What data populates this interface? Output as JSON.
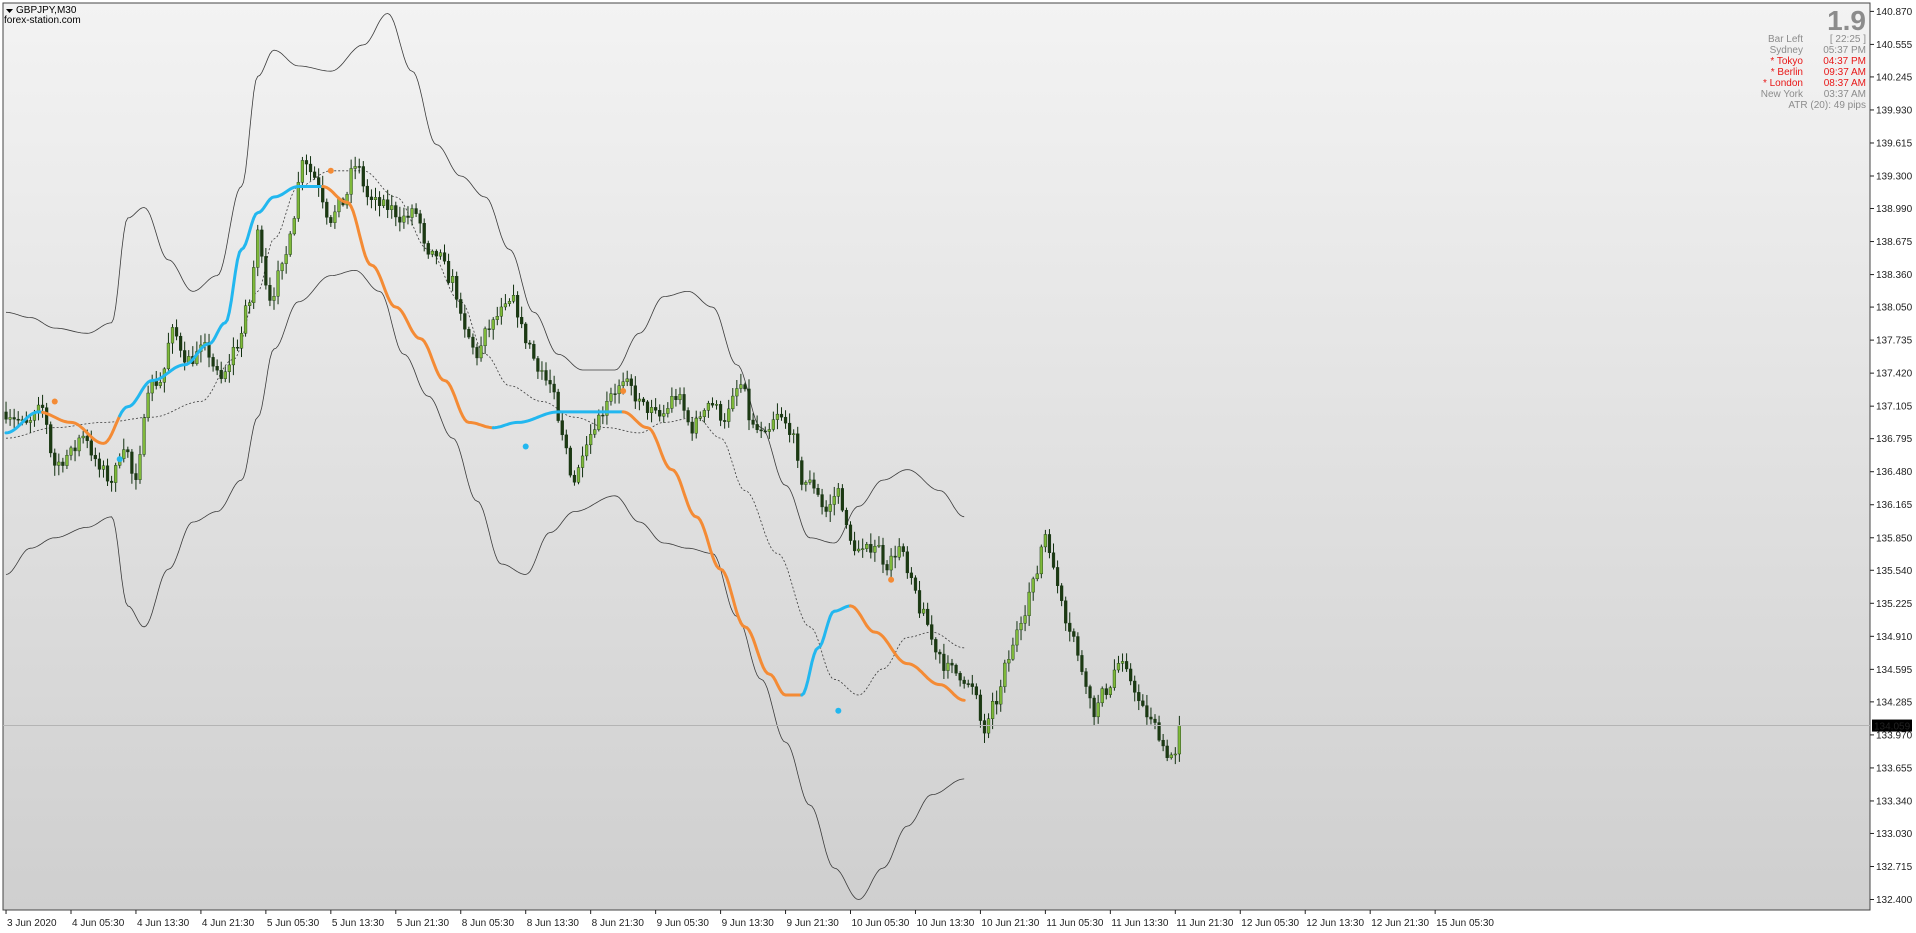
{
  "header": {
    "symbol_timeframe": "GBPJPY,M30",
    "source_watermark": "forex-station.com"
  },
  "info_panel": {
    "big_value": "1.9",
    "rows": [
      {
        "label": "Bar Left",
        "value": "[ 22:25 ]",
        "color": "#8c8c8c"
      },
      {
        "label": "Sydney",
        "value": "05:37 PM",
        "color": "#8c8c8c"
      },
      {
        "label": "* Tokyo",
        "value": "04:37 PM",
        "color": "#e81717"
      },
      {
        "label": "* Berlin",
        "value": "09:37 AM",
        "color": "#e81717"
      },
      {
        "label": "* London",
        "value": "08:37 AM",
        "color": "#e81717"
      },
      {
        "label": "New York",
        "value": "03:37 AM",
        "color": "#8c8c8c"
      }
    ],
    "atr_text": "ATR (20): 49 pips"
  },
  "colors": {
    "bull": "#7fb93a",
    "bear": "#1c3a12",
    "wick": "#123010",
    "ma_up": "#22b7ef",
    "ma_down": "#f48b35",
    "band": "#3c3c3c",
    "current_price_line": "#b4b4b4",
    "price_tag_bg": "#000000",
    "price_tag_text": "#ffffff"
  },
  "chart_data": {
    "type": "candlestick",
    "symbol": "GBPJPY",
    "timeframe": "M30",
    "ylim": [
      132.3,
      140.95
    ],
    "y_ticks": [
      140.87,
      140.555,
      140.245,
      139.93,
      139.615,
      139.3,
      138.99,
      138.675,
      138.36,
      138.05,
      137.735,
      137.42,
      137.105,
      136.795,
      136.48,
      136.165,
      135.85,
      135.54,
      135.225,
      134.91,
      134.595,
      134.285,
      133.97,
      133.655,
      133.34,
      133.03,
      132.715,
      132.4
    ],
    "x_labels": [
      "3 Jun 2020",
      "4 Jun 05:30",
      "4 Jun 13:30",
      "4 Jun 21:30",
      "5 Jun 05:30",
      "5 Jun 13:30",
      "5 Jun 21:30",
      "8 Jun 05:30",
      "8 Jun 13:30",
      "8 Jun 21:30",
      "9 Jun 05:30",
      "9 Jun 13:30",
      "9 Jun 21:30",
      "10 Jun 05:30",
      "10 Jun 13:30",
      "10 Jun 21:30",
      "11 Jun 05:30",
      "11 Jun 13:30",
      "11 Jun 21:30",
      "12 Jun 05:30",
      "12 Jun 13:30",
      "12 Jun 21:30",
      "15 Jun 05:30"
    ],
    "bars_per_label": 16,
    "current_price": 134.059,
    "price_path": [
      [
        0,
        137.05
      ],
      [
        5,
        136.92
      ],
      [
        9,
        137.08
      ],
      [
        12,
        136.55
      ],
      [
        16,
        136.65
      ],
      [
        19,
        136.85
      ],
      [
        23,
        136.5
      ],
      [
        26,
        136.4
      ],
      [
        29,
        136.75
      ],
      [
        32,
        136.35
      ],
      [
        35,
        137.3
      ],
      [
        38,
        137.35
      ],
      [
        41,
        137.8
      ],
      [
        45,
        137.55
      ],
      [
        49,
        137.65
      ],
      [
        53,
        137.35
      ],
      [
        57,
        137.7
      ],
      [
        60,
        138.1
      ],
      [
        62,
        138.75
      ],
      [
        65,
        138.15
      ],
      [
        68,
        138.4
      ],
      [
        71,
        138.95
      ],
      [
        73,
        139.5
      ],
      [
        76,
        139.3
      ],
      [
        80,
        138.9
      ],
      [
        83,
        139.05
      ],
      [
        86,
        139.4
      ],
      [
        90,
        139.05
      ],
      [
        94,
        139.0
      ],
      [
        98,
        138.9
      ],
      [
        101,
        138.95
      ],
      [
        104,
        138.5
      ],
      [
        106,
        138.55
      ],
      [
        110,
        138.3
      ],
      [
        113,
        137.8
      ],
      [
        116,
        137.6
      ],
      [
        119,
        137.85
      ],
      [
        122,
        138.0
      ],
      [
        125,
        138.1
      ],
      [
        128,
        137.75
      ],
      [
        131,
        137.5
      ],
      [
        134,
        137.3
      ],
      [
        137,
        136.8
      ],
      [
        140,
        136.4
      ],
      [
        143,
        136.8
      ],
      [
        146,
        137.0
      ],
      [
        149,
        137.25
      ],
      [
        153,
        137.3
      ],
      [
        157,
        137.1
      ],
      [
        161,
        137.0
      ],
      [
        165,
        137.2
      ],
      [
        169,
        136.9
      ],
      [
        173,
        137.15
      ],
      [
        177,
        137.0
      ],
      [
        181,
        137.3
      ],
      [
        184,
        136.9
      ],
      [
        187,
        136.8
      ],
      [
        190,
        137.0
      ],
      [
        193,
        136.9
      ],
      [
        196,
        136.4
      ],
      [
        199,
        136.35
      ],
      [
        202,
        136.1
      ],
      [
        205,
        136.3
      ],
      [
        208,
        135.8
      ],
      [
        211,
        135.7
      ],
      [
        214,
        135.8
      ],
      [
        217,
        135.6
      ],
      [
        220,
        135.75
      ],
      [
        223,
        135.4
      ],
      [
        226,
        135.1
      ],
      [
        229,
        134.8
      ],
      [
        232,
        134.6
      ],
      [
        235,
        134.55
      ],
      [
        238,
        134.4
      ],
      [
        241,
        134.0
      ],
      [
        244,
        134.3
      ],
      [
        247,
        134.7
      ],
      [
        250,
        135.1
      ],
      [
        253,
        135.4
      ],
      [
        256,
        135.9
      ],
      [
        259,
        135.4
      ],
      [
        262,
        135.0
      ],
      [
        265,
        134.6
      ],
      [
        268,
        134.2
      ],
      [
        271,
        134.4
      ],
      [
        274,
        134.65
      ],
      [
        277,
        134.5
      ],
      [
        280,
        134.2
      ],
      [
        283,
        134.05
      ],
      [
        286,
        133.8
      ],
      [
        288,
        133.75
      ],
      [
        289,
        134.059
      ]
    ],
    "ma_path": [
      [
        0,
        136.85
      ],
      [
        8,
        137.05
      ],
      [
        16,
        136.95
      ],
      [
        24,
        136.75
      ],
      [
        30,
        137.1
      ],
      [
        36,
        137.35
      ],
      [
        44,
        137.5
      ],
      [
        50,
        137.7
      ],
      [
        54,
        137.9
      ],
      [
        58,
        138.6
      ],
      [
        62,
        138.95
      ],
      [
        66,
        139.1
      ],
      [
        72,
        139.2
      ],
      [
        78,
        139.15
      ],
      [
        84,
        139.0
      ],
      [
        90,
        138.5
      ],
      [
        96,
        138.05
      ],
      [
        102,
        137.8
      ],
      [
        108,
        137.45
      ],
      [
        112,
        137.05
      ],
      [
        118,
        136.85
      ],
      [
        126,
        136.95
      ],
      [
        136,
        137.05
      ],
      [
        146,
        137.1
      ],
      [
        152,
        137.05
      ],
      [
        160,
        136.7
      ],
      [
        168,
        136.2
      ],
      [
        176,
        135.8
      ],
      [
        182,
        135.4
      ],
      [
        188,
        134.9
      ],
      [
        194,
        134.4
      ],
      [
        198,
        134.3
      ],
      [
        204,
        134.9
      ],
      [
        208,
        135.15
      ],
      [
        214,
        134.8
      ],
      [
        224,
        134.55
      ],
      [
        232,
        134.35
      ],
      [
        240,
        134.2
      ],
      [
        250,
        134.1
      ],
      [
        260,
        134.0
      ],
      [
        270,
        133.95
      ],
      [
        280,
        133.85
      ],
      [
        289,
        133.8
      ]
    ],
    "ma_display": [
      [
        0,
        136.85
      ],
      [
        8,
        137.05
      ],
      [
        16,
        136.95
      ],
      [
        24,
        136.75
      ],
      [
        30,
        137.1
      ],
      [
        36,
        137.35
      ],
      [
        44,
        137.5
      ],
      [
        50,
        137.7
      ],
      [
        54,
        137.9
      ],
      [
        58,
        138.6
      ],
      [
        62,
        138.95
      ],
      [
        66,
        139.1
      ],
      [
        72,
        139.2
      ],
      [
        78,
        139.2
      ],
      [
        84,
        139.05
      ],
      [
        90,
        138.45
      ],
      [
        96,
        138.05
      ],
      [
        102,
        137.75
      ],
      [
        108,
        137.35
      ],
      [
        114,
        136.95
      ],
      [
        120,
        136.9
      ],
      [
        126,
        136.95
      ],
      [
        136,
        137.05
      ],
      [
        146,
        137.05
      ],
      [
        152,
        137.05
      ],
      [
        158,
        136.9
      ],
      [
        164,
        136.5
      ],
      [
        170,
        136.05
      ],
      [
        176,
        135.55
      ],
      [
        182,
        135.0
      ],
      [
        188,
        134.55
      ],
      [
        192,
        134.35
      ],
      [
        196,
        134.35
      ],
      [
        200,
        134.8
      ],
      [
        204,
        135.15
      ],
      [
        208,
        135.2
      ],
      [
        214,
        134.95
      ],
      [
        222,
        134.65
      ],
      [
        230,
        134.45
      ],
      [
        236,
        134.3
      ]
    ],
    "ma_segments": [
      {
        "from": 0,
        "to": 9,
        "trend": "up"
      },
      {
        "from": 9,
        "to": 28,
        "trend": "down"
      },
      {
        "from": 28,
        "to": 78,
        "trend": "up"
      },
      {
        "from": 78,
        "to": 120,
        "trend": "down"
      },
      {
        "from": 120,
        "to": 152,
        "trend": "up"
      },
      {
        "from": 152,
        "to": 196,
        "trend": "down"
      },
      {
        "from": 196,
        "to": 208,
        "trend": "up"
      },
      {
        "from": 208,
        "to": 236,
        "trend": "down"
      }
    ],
    "signal_dots": [
      {
        "x": 12,
        "y": 137.15,
        "trend": "down"
      },
      {
        "x": 28,
        "y": 136.6,
        "trend": "up"
      },
      {
        "x": 80,
        "y": 139.35,
        "trend": "down"
      },
      {
        "x": 128,
        "y": 136.72,
        "trend": "up"
      },
      {
        "x": 152,
        "y": 137.25,
        "trend": "down"
      },
      {
        "x": 205,
        "y": 134.2,
        "trend": "up"
      },
      {
        "x": 218,
        "y": 135.45,
        "trend": "down"
      }
    ],
    "band_mid": [
      [
        0,
        136.8
      ],
      [
        12,
        136.9
      ],
      [
        24,
        136.95
      ],
      [
        36,
        137.0
      ],
      [
        48,
        137.15
      ],
      [
        56,
        137.55
      ],
      [
        62,
        138.2
      ],
      [
        66,
        138.7
      ],
      [
        72,
        139.2
      ],
      [
        80,
        139.35
      ],
      [
        88,
        139.35
      ],
      [
        96,
        139.1
      ],
      [
        104,
        138.6
      ],
      [
        112,
        138.1
      ],
      [
        118,
        137.6
      ],
      [
        124,
        137.3
      ],
      [
        132,
        137.15
      ],
      [
        140,
        137.0
      ],
      [
        148,
        136.9
      ],
      [
        156,
        136.85
      ],
      [
        162,
        136.95
      ],
      [
        170,
        137.0
      ],
      [
        176,
        136.8
      ],
      [
        182,
        136.3
      ],
      [
        190,
        135.7
      ],
      [
        198,
        135.0
      ],
      [
        204,
        134.5
      ],
      [
        210,
        134.35
      ],
      [
        216,
        134.6
      ],
      [
        222,
        134.9
      ],
      [
        228,
        134.95
      ],
      [
        236,
        134.8
      ]
    ],
    "band_upper": [
      [
        0,
        138.0
      ],
      [
        6,
        137.95
      ],
      [
        12,
        137.85
      ],
      [
        20,
        137.8
      ],
      [
        26,
        137.9
      ],
      [
        30,
        138.9
      ],
      [
        34,
        139.0
      ],
      [
        40,
        138.5
      ],
      [
        46,
        138.2
      ],
      [
        52,
        138.35
      ],
      [
        58,
        139.2
      ],
      [
        62,
        140.25
      ],
      [
        66,
        140.5
      ],
      [
        72,
        140.35
      ],
      [
        80,
        140.3
      ],
      [
        88,
        140.55
      ],
      [
        94,
        140.85
      ],
      [
        100,
        140.3
      ],
      [
        106,
        139.6
      ],
      [
        112,
        139.3
      ],
      [
        118,
        139.1
      ],
      [
        124,
        138.6
      ],
      [
        130,
        138.0
      ],
      [
        136,
        137.6
      ],
      [
        142,
        137.45
      ],
      [
        150,
        137.45
      ],
      [
        156,
        137.8
      ],
      [
        162,
        138.15
      ],
      [
        168,
        138.2
      ],
      [
        174,
        138.05
      ],
      [
        180,
        137.5
      ],
      [
        186,
        136.9
      ],
      [
        192,
        136.35
      ],
      [
        198,
        135.85
      ],
      [
        204,
        135.8
      ],
      [
        210,
        136.15
      ],
      [
        216,
        136.4
      ],
      [
        222,
        136.5
      ],
      [
        230,
        136.3
      ],
      [
        236,
        136.05
      ]
    ],
    "band_lower": [
      [
        0,
        135.5
      ],
      [
        6,
        135.75
      ],
      [
        12,
        135.85
      ],
      [
        20,
        135.95
      ],
      [
        26,
        136.05
      ],
      [
        30,
        135.2
      ],
      [
        34,
        135.0
      ],
      [
        40,
        135.55
      ],
      [
        46,
        136.0
      ],
      [
        52,
        136.1
      ],
      [
        58,
        136.4
      ],
      [
        62,
        137.0
      ],
      [
        66,
        137.65
      ],
      [
        72,
        138.1
      ],
      [
        80,
        138.35
      ],
      [
        86,
        138.4
      ],
      [
        92,
        138.2
      ],
      [
        98,
        137.6
      ],
      [
        104,
        137.2
      ],
      [
        110,
        136.8
      ],
      [
        116,
        136.2
      ],
      [
        122,
        135.6
      ],
      [
        128,
        135.5
      ],
      [
        134,
        135.9
      ],
      [
        140,
        136.1
      ],
      [
        150,
        136.25
      ],
      [
        156,
        136.0
      ],
      [
        162,
        135.8
      ],
      [
        168,
        135.75
      ],
      [
        174,
        135.7
      ],
      [
        180,
        135.1
      ],
      [
        186,
        134.5
      ],
      [
        192,
        133.9
      ],
      [
        198,
        133.3
      ],
      [
        204,
        132.7
      ],
      [
        210,
        132.4
      ],
      [
        216,
        132.7
      ],
      [
        222,
        133.1
      ],
      [
        228,
        133.4
      ],
      [
        236,
        133.55
      ]
    ]
  }
}
